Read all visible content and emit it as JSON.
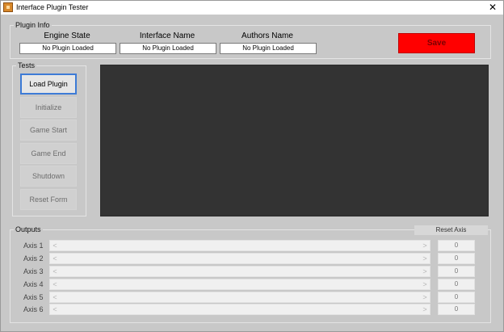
{
  "window": {
    "title": "Interface Plugin Tester",
    "close_symbol": "✕"
  },
  "plugin_info": {
    "group_title": "Plugin Info",
    "engine_state": {
      "label": "Engine State",
      "value": "No Plugin Loaded"
    },
    "interface_name": {
      "label": "Interface Name",
      "value": "No Plugin Loaded"
    },
    "authors_name": {
      "label": "Authors Name",
      "value": "No Plugin Loaded"
    },
    "save_label": "Save"
  },
  "tests": {
    "group_title": "Tests",
    "buttons": [
      "Load Plugin",
      "Initialize",
      "Game Start",
      "Game End",
      "Shutdown",
      "Reset Form"
    ]
  },
  "outputs": {
    "group_title": "Outputs",
    "reset_axis_label": "Reset Axis",
    "axes": [
      {
        "label": "Axis 1",
        "value": "0"
      },
      {
        "label": "Axis 2",
        "value": "0"
      },
      {
        "label": "Axis 3",
        "value": "0"
      },
      {
        "label": "Axis 4",
        "value": "0"
      },
      {
        "label": "Axis 5",
        "value": "0"
      },
      {
        "label": "Axis 6",
        "value": "0"
      }
    ],
    "scroll_left": "<",
    "scroll_right": ">"
  },
  "colors": {
    "save": "#ff0000",
    "canvas": "#333333",
    "focus": "#3d7bd6"
  }
}
